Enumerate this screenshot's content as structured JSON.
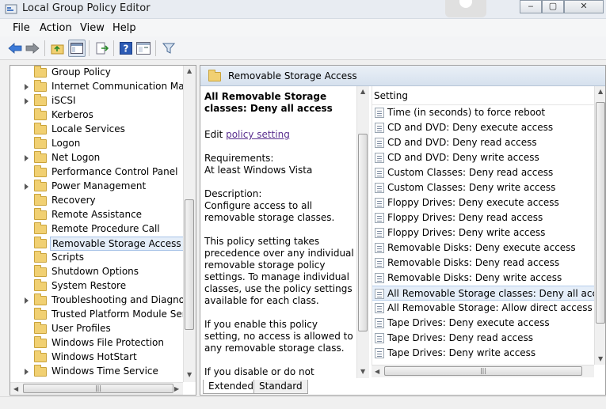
{
  "window": {
    "title": "Local Group Policy Editor"
  },
  "menu": [
    "File",
    "Action",
    "View",
    "Help"
  ],
  "toolbar": {
    "icons": [
      "back-arrow-icon",
      "forward-arrow-icon",
      "up-folder-icon",
      "show-hide-tree-icon",
      "export-list-icon",
      "help-icon",
      "properties-icon",
      "filter-icon"
    ]
  },
  "tree": {
    "items": [
      {
        "label": "Group Policy",
        "expandable": false
      },
      {
        "label": "Internet Communication Mana",
        "expandable": true
      },
      {
        "label": "iSCSI",
        "expandable": true
      },
      {
        "label": "Kerberos",
        "expandable": false
      },
      {
        "label": "Locale Services",
        "expandable": false
      },
      {
        "label": "Logon",
        "expandable": false
      },
      {
        "label": "Net Logon",
        "expandable": true
      },
      {
        "label": "Performance Control Panel",
        "expandable": false
      },
      {
        "label": "Power Management",
        "expandable": true
      },
      {
        "label": "Recovery",
        "expandable": false
      },
      {
        "label": "Remote Assistance",
        "expandable": false
      },
      {
        "label": "Remote Procedure Call",
        "expandable": false
      },
      {
        "label": "Removable Storage Access",
        "expandable": false,
        "selected": true
      },
      {
        "label": "Scripts",
        "expandable": false
      },
      {
        "label": "Shutdown Options",
        "expandable": false
      },
      {
        "label": "System Restore",
        "expandable": false
      },
      {
        "label": "Troubleshooting and Diagnosti",
        "expandable": true
      },
      {
        "label": "Trusted Platform Module Servic",
        "expandable": false
      },
      {
        "label": "User Profiles",
        "expandable": false
      },
      {
        "label": "Windows File Protection",
        "expandable": false
      },
      {
        "label": "Windows HotStart",
        "expandable": false
      },
      {
        "label": "Windows Time Service",
        "expandable": true
      }
    ]
  },
  "right_pane": {
    "header_title": "Removable Storage Access",
    "description": {
      "title": "All Removable Storage classes: Deny all access",
      "edit_prefix": "Edit",
      "edit_link": "policy setting",
      "requirements_heading": "Requirements:",
      "requirements_text": "At least Windows Vista",
      "description_heading": "Description:",
      "description_text": "Configure access to all removable storage classes.",
      "paragraph1": "This policy setting takes precedence over any individual removable storage policy settings. To manage individual classes, use the policy settings available for each class.",
      "paragraph2": "If you enable this policy setting, no access is allowed to any removable storage class.",
      "paragraph3": "If you disable or do not configure"
    },
    "list": {
      "column_header": "Setting",
      "items": [
        {
          "label": "Time (in seconds) to force reboot"
        },
        {
          "label": "CD and DVD: Deny execute access"
        },
        {
          "label": "CD and DVD: Deny read access"
        },
        {
          "label": "CD and DVD: Deny write access"
        },
        {
          "label": "Custom Classes: Deny read access"
        },
        {
          "label": "Custom Classes: Deny write access"
        },
        {
          "label": "Floppy Drives: Deny execute access"
        },
        {
          "label": "Floppy Drives: Deny read access"
        },
        {
          "label": "Floppy Drives: Deny write access"
        },
        {
          "label": "Removable Disks: Deny execute access"
        },
        {
          "label": "Removable Disks: Deny read access"
        },
        {
          "label": "Removable Disks: Deny write access"
        },
        {
          "label": "All Removable Storage classes: Deny all access",
          "selected": true
        },
        {
          "label": "All Removable Storage: Allow direct access in re"
        },
        {
          "label": "Tape Drives: Deny execute access"
        },
        {
          "label": "Tape Drives: Deny read access"
        },
        {
          "label": "Tape Drives: Deny write access"
        }
      ]
    }
  },
  "tabs": [
    {
      "label": "Extended",
      "active": true
    },
    {
      "label": "Standard",
      "active": false
    }
  ],
  "colors": {
    "selection": "#e5eef9",
    "link": "#5a2f8f",
    "header_gradient": "#d6e1ee"
  }
}
